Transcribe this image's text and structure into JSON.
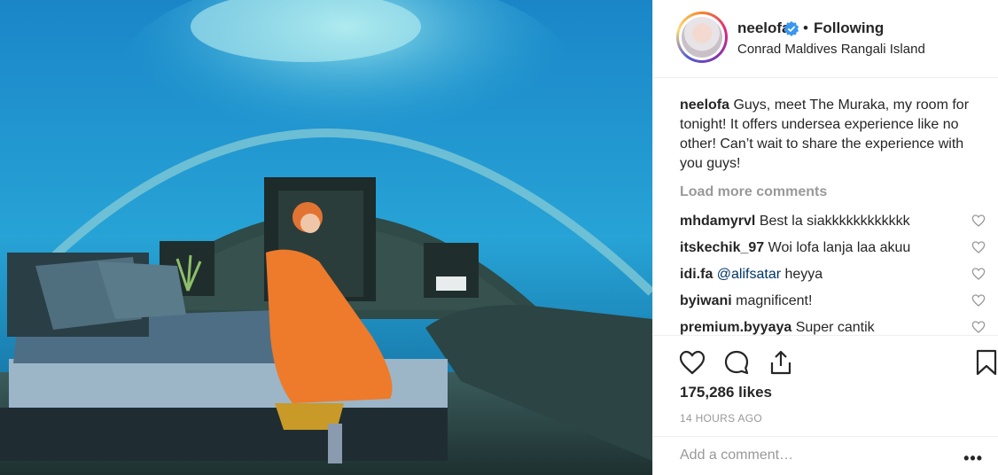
{
  "photo": {
    "description_icon": "post-photo"
  },
  "header": {
    "username": "neelofa",
    "separator": "•",
    "follow_state": "Following",
    "location": "Conrad Maldives Rangali Island",
    "verified_color": "#3897f0"
  },
  "caption": {
    "username": "neelofa",
    "text": " Guys, meet The Muraka, my room for tonight! It offers undersea experience like no other! Can’t wait to share the experience with you guys!"
  },
  "load_more": "Load more comments",
  "comments": [
    {
      "user": "mhdamyrvl",
      "text": " Best la siakkkkkkkkkkkk",
      "mention": ""
    },
    {
      "user": "itskechik_97",
      "text": " Woi lofa lanja laa akuu",
      "mention": ""
    },
    {
      "user": "idi.fa",
      "text": " heyya",
      "mention": " @alifsatar"
    },
    {
      "user": "byiwani",
      "text": " magnificent!",
      "mention": ""
    },
    {
      "user": "premium.byyaya",
      "text": " Super cantik",
      "mention": ""
    }
  ],
  "likes": "175,286 likes",
  "timestamp": "14 HOURS AGO",
  "add_comment": {
    "placeholder": "Add a comment…",
    "more": "•••"
  }
}
